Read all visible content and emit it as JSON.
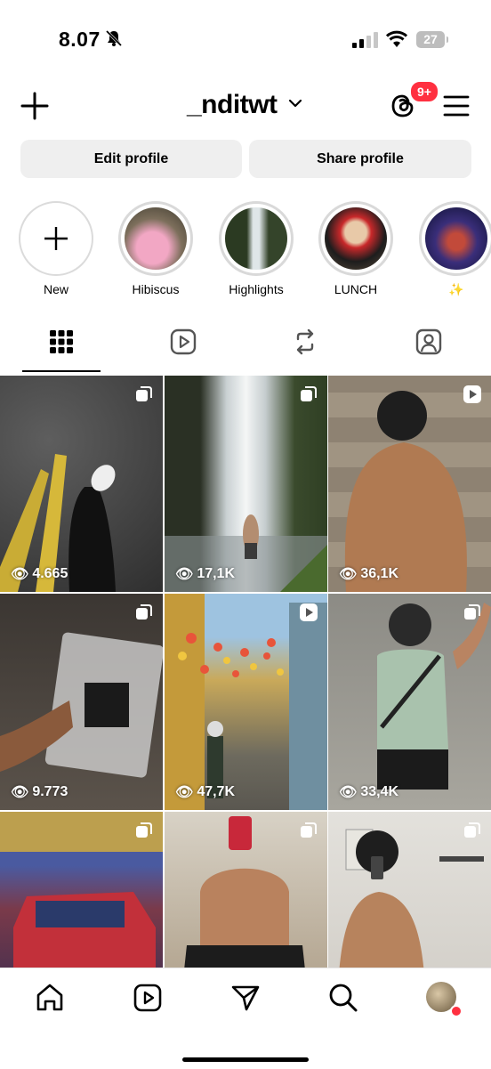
{
  "status_bar": {
    "time": "8.07",
    "battery": "27"
  },
  "header": {
    "username": "_nditwt",
    "notification_badge": "9+"
  },
  "buttons": {
    "edit_profile": "Edit profile",
    "share_profile": "Share profile"
  },
  "highlights": [
    {
      "label": "New"
    },
    {
      "label": "Hibiscus"
    },
    {
      "label": "Highlights"
    },
    {
      "label": "LUNCH"
    },
    {
      "label": "✨"
    }
  ],
  "tabs": [
    "posts-grid-icon",
    "reels-icon",
    "reposts-icon",
    "tagged-icon"
  ],
  "posts": [
    {
      "views": "4.665",
      "type": "carousel"
    },
    {
      "views": "17,1K",
      "type": "carousel"
    },
    {
      "views": "36,1K",
      "type": "reel"
    },
    {
      "views": "9.773",
      "type": "carousel"
    },
    {
      "views": "47,7K",
      "type": "reel"
    },
    {
      "views": "33,4K",
      "type": "carousel"
    },
    {
      "views": "",
      "type": "carousel"
    },
    {
      "views": "",
      "type": "carousel"
    },
    {
      "views": "",
      "type": "carousel"
    }
  ],
  "nav": [
    "home-icon",
    "reels-icon",
    "send-icon",
    "search-icon",
    "profile-avatar"
  ],
  "colors": {
    "badge": "#ff3040",
    "button_bg": "#efefef"
  }
}
